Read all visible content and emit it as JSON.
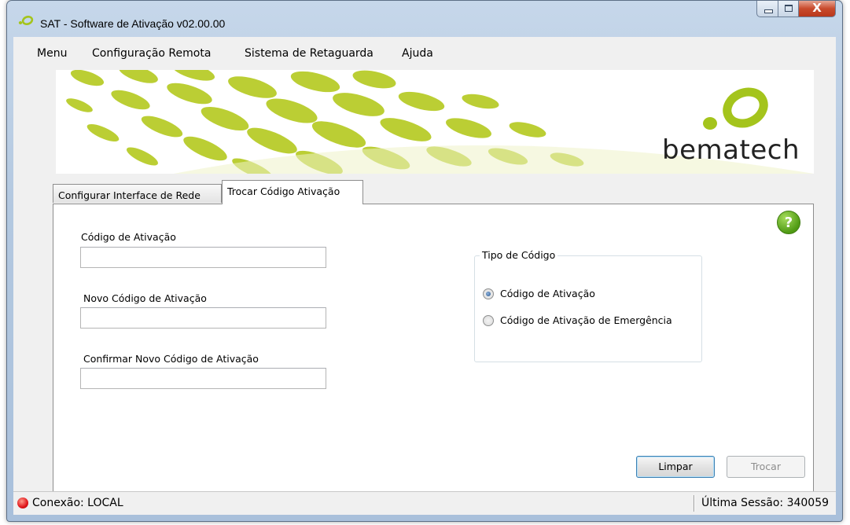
{
  "window": {
    "title": "SAT - Software de Ativação v02.00.00",
    "controls": {
      "minimize": "minimize-icon",
      "maximize": "maximize-icon",
      "close": "X"
    }
  },
  "menu": {
    "items": [
      {
        "label": "Menu"
      },
      {
        "label": "Configuração Remota"
      },
      {
        "label": "Sistema de Retaguarda"
      },
      {
        "label": "Ajuda"
      }
    ]
  },
  "banner": {
    "brand": "bematech",
    "brand_color": "#a4c41c"
  },
  "tabs": [
    {
      "label": "Configurar Interface de Rede",
      "active": false
    },
    {
      "label": "Trocar Código Ativação",
      "active": true
    }
  ],
  "form": {
    "fields": [
      {
        "label": "Código de Ativação",
        "value": ""
      },
      {
        "label": "Novo Código de Ativação",
        "value": ""
      },
      {
        "label": "Confirmar Novo Código de Ativação",
        "value": ""
      }
    ],
    "help": {
      "label": "?",
      "icon": "help-icon",
      "color": "#5aa81a"
    },
    "tipo_codigo": {
      "title": "Tipo de Código",
      "options": [
        {
          "label": "Código de Ativação",
          "selected": true
        },
        {
          "label": "Código de Ativação de Emergência",
          "selected": false
        }
      ]
    },
    "buttons": {
      "limpar": "Limpar",
      "trocar": "Trocar"
    }
  },
  "status": {
    "connection": "Conexão: LOCAL",
    "connection_color": "#e0151a",
    "last_session": "Última Sessão: 340059"
  }
}
